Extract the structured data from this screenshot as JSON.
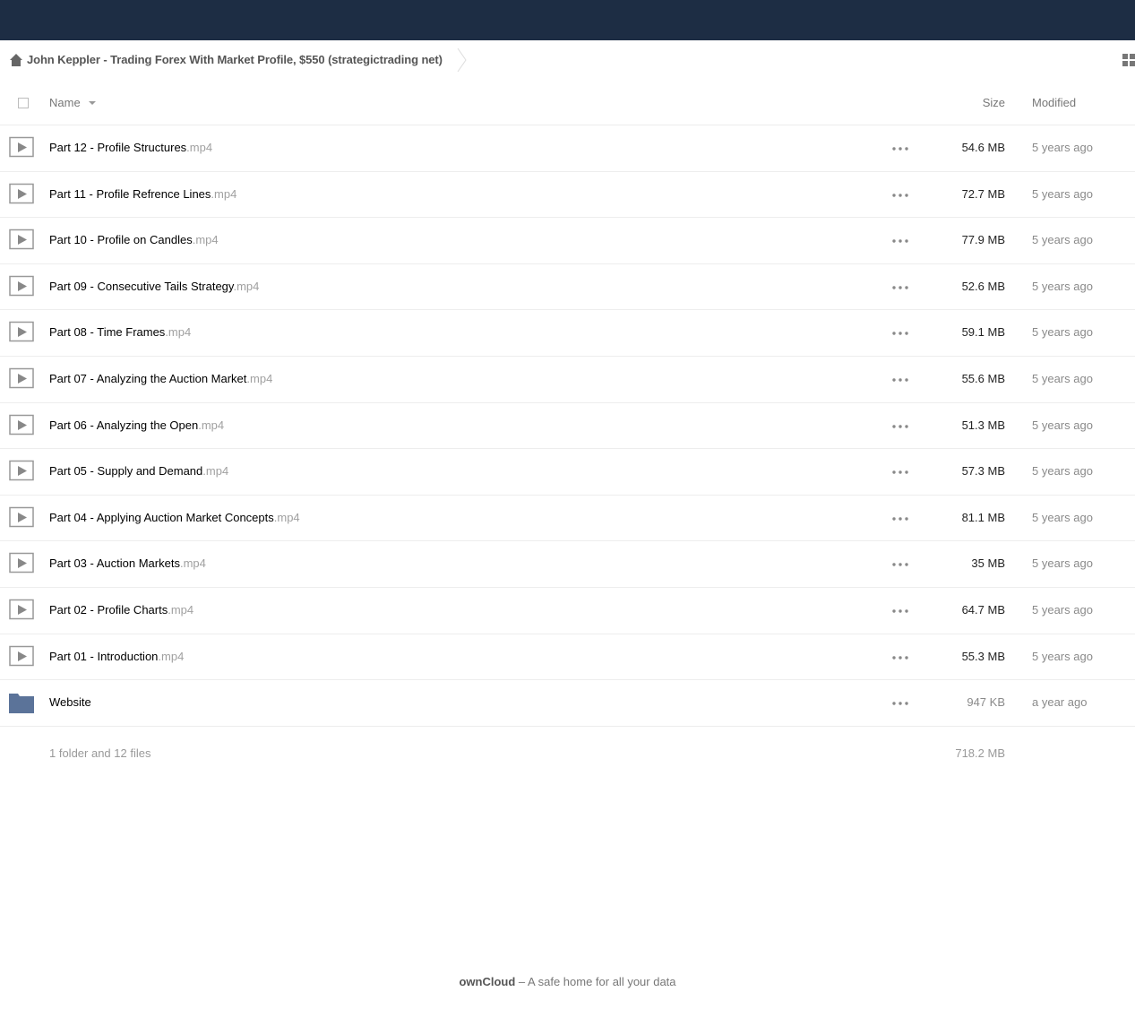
{
  "breadcrumb": {
    "home_icon": "home-icon",
    "title": "John Keppler - Trading Forex With Market Profile, $550 (strategictrading net)"
  },
  "header": {
    "name_label": "Name",
    "size_label": "Size",
    "modified_label": "Modified"
  },
  "files": [
    {
      "name": "Part 12 - Profile Structures",
      "ext": ".mp4",
      "size": "54.6 MB",
      "modified": "5 years ago",
      "icon": "video-file-icon"
    },
    {
      "name": "Part 11 - Profile Refrence Lines",
      "ext": ".mp4",
      "size": "72.7 MB",
      "modified": "5 years ago",
      "icon": "video-file-icon"
    },
    {
      "name": "Part 10 - Profile on Candles",
      "ext": ".mp4",
      "size": "77.9 MB",
      "modified": "5 years ago",
      "icon": "video-file-icon"
    },
    {
      "name": "Part 09 - Consecutive Tails Strategy",
      "ext": ".mp4",
      "size": "52.6 MB",
      "modified": "5 years ago",
      "icon": "video-file-icon"
    },
    {
      "name": "Part 08 - Time Frames",
      "ext": ".mp4",
      "size": "59.1 MB",
      "modified": "5 years ago",
      "icon": "video-file-icon"
    },
    {
      "name": "Part 07 - Analyzing the Auction Market",
      "ext": ".mp4",
      "size": "55.6 MB",
      "modified": "5 years ago",
      "icon": "video-file-icon"
    },
    {
      "name": "Part 06 - Analyzing the Open",
      "ext": ".mp4",
      "size": "51.3 MB",
      "modified": "5 years ago",
      "icon": "video-file-icon"
    },
    {
      "name": "Part 05 - Supply and Demand",
      "ext": ".mp4",
      "size": "57.3 MB",
      "modified": "5 years ago",
      "icon": "video-file-icon"
    },
    {
      "name": "Part 04 - Applying Auction Market Concepts",
      "ext": ".mp4",
      "size": "81.1 MB",
      "modified": "5 years ago",
      "icon": "video-file-icon"
    },
    {
      "name": "Part 03 - Auction Markets",
      "ext": ".mp4",
      "size": "35 MB",
      "modified": "5 years ago",
      "icon": "video-file-icon"
    },
    {
      "name": "Part 02 - Profile Charts",
      "ext": ".mp4",
      "size": "64.7 MB",
      "modified": "5 years ago",
      "icon": "video-file-icon"
    },
    {
      "name": "Part 01 - Introduction",
      "ext": ".mp4",
      "size": "55.3 MB",
      "modified": "5 years ago",
      "icon": "video-file-icon"
    },
    {
      "name": "Website",
      "ext": "",
      "size": "947 KB",
      "modified": "a year ago",
      "icon": "folder-icon",
      "is_folder": true
    }
  ],
  "summary": {
    "text": "1 folder and 12 files",
    "total_size": "718.2 MB"
  },
  "footer": {
    "brand": "ownCloud",
    "tagline": " – A safe home for all your data"
  },
  "colors": {
    "topbar": "#1d2d44",
    "folder": "#5b7399"
  }
}
